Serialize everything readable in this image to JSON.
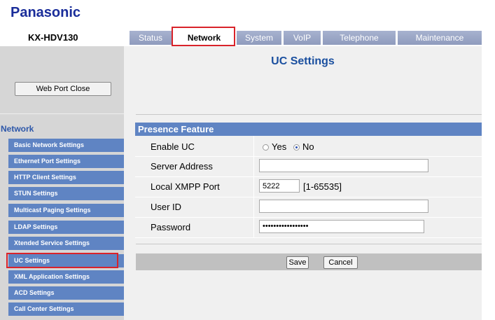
{
  "header": {
    "brand": "Panasonic",
    "model": "KX-HDV130",
    "tabs": [
      {
        "label": "Status"
      },
      {
        "label": "Network"
      },
      {
        "label": "System"
      },
      {
        "label": "VoIP"
      },
      {
        "label": "Telephone"
      },
      {
        "label": "Maintenance"
      }
    ],
    "active_tab": "Network"
  },
  "sidebar": {
    "web_port_button": "Web Port Close",
    "section_title": "Network",
    "items": [
      {
        "label": "Basic Network Settings"
      },
      {
        "label": "Ethernet Port Settings"
      },
      {
        "label": "HTTP Client Settings"
      },
      {
        "label": "STUN Settings"
      },
      {
        "label": "Multicast Paging Settings"
      },
      {
        "label": "LDAP Settings"
      },
      {
        "label": "Xtended Service Settings"
      },
      {
        "label": "UC Settings"
      },
      {
        "label": "XML Application Settings"
      },
      {
        "label": "ACD Settings"
      },
      {
        "label": "Call Center Settings"
      }
    ],
    "highlighted_item": "UC Settings"
  },
  "main": {
    "title": "UC Settings",
    "section": "Presence Feature",
    "fields": {
      "enable_uc": {
        "label": "Enable UC",
        "options": [
          "Yes",
          "No"
        ],
        "selected": "No"
      },
      "server_address": {
        "label": "Server Address",
        "value": ""
      },
      "local_xmpp_port": {
        "label": "Local XMPP Port",
        "value": "5222",
        "range": "[1-65535]"
      },
      "user_id": {
        "label": "User ID",
        "value": ""
      },
      "password": {
        "label": "Password",
        "value": "•••••••••••••••••"
      }
    },
    "actions": {
      "save": "Save",
      "cancel": "Cancel"
    }
  },
  "colors": {
    "brand": "#1a2d9a",
    "nav_item_bg": "#5f84c3",
    "highlight_border": "#d9232a",
    "title": "#1a4f9f"
  }
}
